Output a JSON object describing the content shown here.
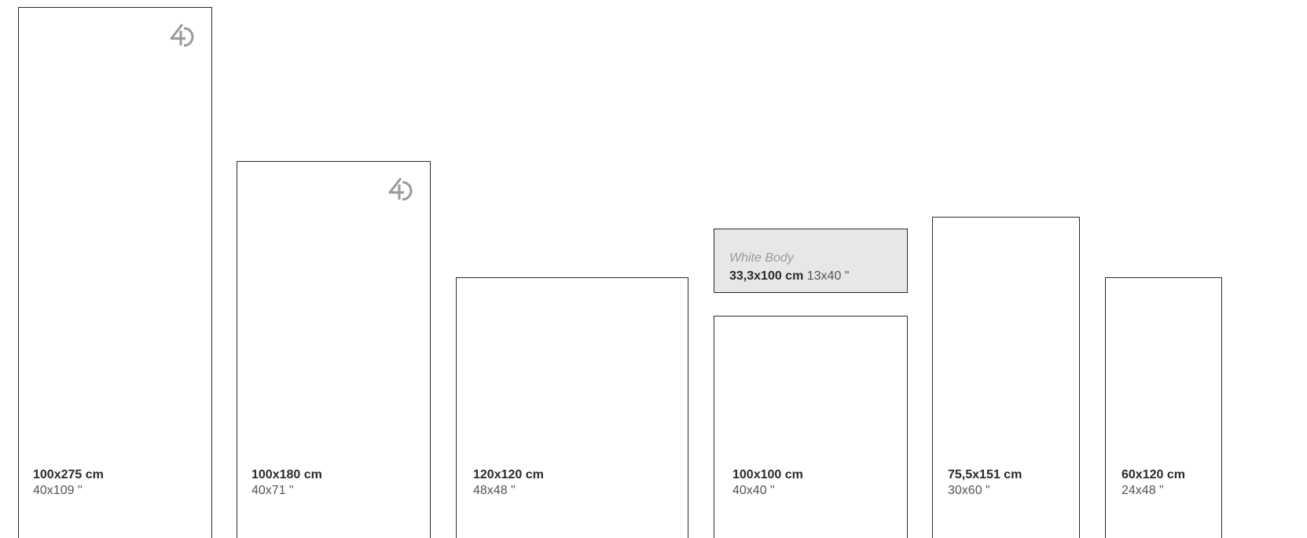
{
  "colors": {
    "border": "#2a2a2a",
    "highlight_background": "#e6e7e8",
    "logo": "#9a9a9a"
  },
  "tiles": [
    {
      "size_cm": "100x275 cm",
      "size_inch": "40x109 \"",
      "has_logo": true
    },
    {
      "size_cm": "100x180 cm",
      "size_inch": "40x71 \"",
      "has_logo": true
    },
    {
      "size_cm": "120x120 cm",
      "size_inch": "48x48 \"",
      "has_logo": false
    },
    {
      "size_cm": "100x100 cm",
      "size_inch": "40x40 \"",
      "has_logo": false
    },
    {
      "size_cm": "75,5x151 cm",
      "size_inch": "30x60 \"",
      "has_logo": false
    },
    {
      "size_cm": "60x120 cm",
      "size_inch": "24x48 \"",
      "has_logo": false
    }
  ],
  "white_body": {
    "title": "White Body",
    "size_cm": "33,3x100 cm",
    "size_inch": "13x40 \""
  },
  "logo_icon": "4d-logo-icon"
}
